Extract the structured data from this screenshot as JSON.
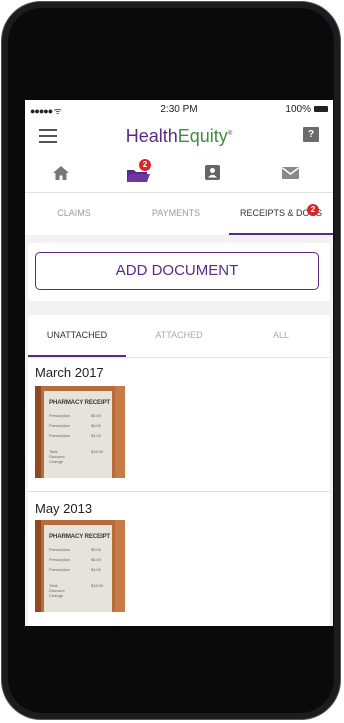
{
  "status_bar": {
    "signal": "●●●●● ᯤ",
    "time": "2:30 PM",
    "battery": "100%"
  },
  "app": {
    "brand_part1": "Health",
    "brand_part2": "Equity",
    "trademark": "®",
    "help_label": "?"
  },
  "icon_nav": {
    "docs_badge": "2"
  },
  "top_tabs": [
    {
      "label": "CLAIMS",
      "active": false
    },
    {
      "label": "PAYMENTS",
      "active": false
    },
    {
      "label": "RECEIPTS & DOCS",
      "active": true,
      "badge": "2"
    }
  ],
  "add_document": {
    "label": "ADD DOCUMENT"
  },
  "doc_tabs": [
    {
      "label": "UNATTACHED",
      "active": true
    },
    {
      "label": "ATTACHED",
      "active": false
    },
    {
      "label": "ALL",
      "active": false
    }
  ],
  "groups": [
    {
      "title": "March 2017"
    },
    {
      "title": "May 2013"
    }
  ],
  "receipt": {
    "title": "PHARMACY RECEIPT",
    "rows": [
      {
        "label": "Prescription",
        "value": "$5.00"
      },
      {
        "label": "Prescription",
        "value": "$6.00"
      },
      {
        "label": "Prescription",
        "value": "$4.00"
      },
      {
        "label": "Total",
        "value": "$15.00"
      },
      {
        "label": "Discount",
        "value": ""
      },
      {
        "label": "Change",
        "value": ""
      }
    ]
  },
  "colors": {
    "brand_purple": "#5b2a86",
    "brand_green": "#3e8e3e",
    "badge_red": "#d9262c"
  }
}
